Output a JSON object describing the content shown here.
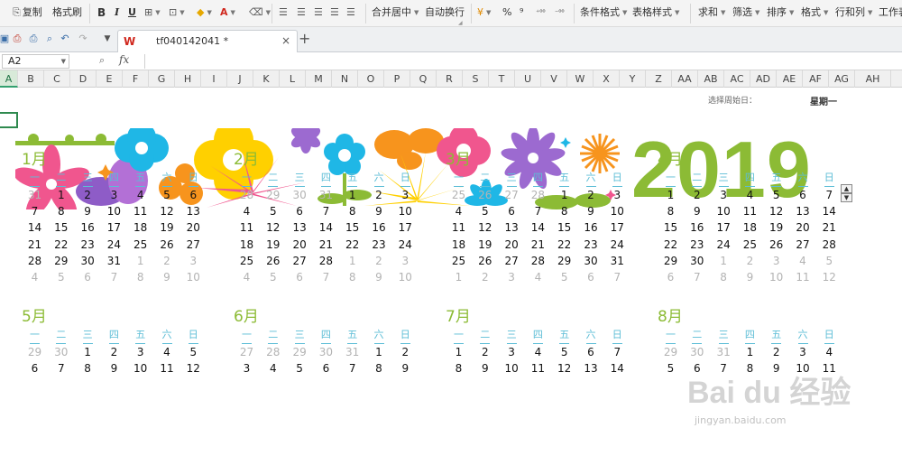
{
  "ribbon": {
    "copy": "复制",
    "format_painter": "格式刷",
    "bold": "B",
    "italic": "I",
    "underline": "U",
    "merge_center": "合并居中",
    "wrap_text": "自动换行",
    "percent": "%",
    "thousands": "⁹",
    "decimal_more": "⁺⁰⁰",
    "decimal_less": "⁻⁰⁰",
    "cond_format": "条件格式",
    "table_style": "表格样式",
    "sum": "求和",
    "filter": "筛选",
    "sort": "排序",
    "format": "格式",
    "row_col": "行和列",
    "worksheet": "工作表"
  },
  "tabbar": {
    "wps_logo": "W",
    "doc_title": "tf040142041 *",
    "close": "×",
    "new_tab": "+"
  },
  "formula_bar": {
    "name_box": "A2",
    "fx": "fx"
  },
  "columns": [
    "A",
    "B",
    "C",
    "D",
    "E",
    "F",
    "G",
    "H",
    "I",
    "J",
    "K",
    "L",
    "M",
    "N",
    "O",
    "P",
    "Q",
    "R",
    "S",
    "T",
    "U",
    "V",
    "W",
    "X",
    "Y",
    "Z",
    "AA",
    "AB",
    "AC",
    "AD",
    "AE",
    "AF",
    "AG",
    "AH"
  ],
  "sheet": {
    "select_start_label": "选择周始日：",
    "start_day": "星期一",
    "year": "2019",
    "weekdays": [
      "一",
      "二",
      "三",
      "四",
      "五",
      "六",
      "日"
    ],
    "months": [
      {
        "name": "1月",
        "rows": [
          [
            "31",
            "1",
            "2",
            "3",
            "4",
            "5",
            "6"
          ],
          [
            "7",
            "8",
            "9",
            "10",
            "11",
            "12",
            "13"
          ],
          [
            "14",
            "15",
            "16",
            "17",
            "18",
            "19",
            "20"
          ],
          [
            "21",
            "22",
            "23",
            "24",
            "25",
            "26",
            "27"
          ],
          [
            "28",
            "29",
            "30",
            "31",
            "1",
            "2",
            "3"
          ],
          [
            "4",
            "5",
            "6",
            "7",
            "8",
            "9",
            "10"
          ]
        ],
        "first": 1,
        "last": 31
      },
      {
        "name": "2月",
        "rows": [
          [
            "28",
            "29",
            "30",
            "31",
            "1",
            "2",
            "3"
          ],
          [
            "4",
            "5",
            "6",
            "7",
            "8",
            "9",
            "10"
          ],
          [
            "11",
            "12",
            "13",
            "14",
            "15",
            "16",
            "17"
          ],
          [
            "18",
            "19",
            "20",
            "21",
            "22",
            "23",
            "24"
          ],
          [
            "25",
            "26",
            "27",
            "28",
            "1",
            "2",
            "3"
          ],
          [
            "4",
            "5",
            "6",
            "7",
            "8",
            "9",
            "10"
          ]
        ],
        "first": 4,
        "last": 31
      },
      {
        "name": "3月",
        "rows": [
          [
            "25",
            "26",
            "27",
            "28",
            "1",
            "2",
            "3"
          ],
          [
            "4",
            "5",
            "6",
            "7",
            "8",
            "9",
            "10"
          ],
          [
            "11",
            "12",
            "13",
            "14",
            "15",
            "16",
            "17"
          ],
          [
            "18",
            "19",
            "20",
            "21",
            "22",
            "23",
            "24"
          ],
          [
            "25",
            "26",
            "27",
            "28",
            "29",
            "30",
            "31"
          ],
          [
            "1",
            "2",
            "3",
            "4",
            "5",
            "6",
            "7"
          ]
        ],
        "first": 4,
        "last": 34
      },
      {
        "name": "4月",
        "rows": [
          [
            "1",
            "2",
            "3",
            "4",
            "5",
            "6",
            "7"
          ],
          [
            "8",
            "9",
            "10",
            "11",
            "12",
            "13",
            "14"
          ],
          [
            "15",
            "16",
            "17",
            "18",
            "19",
            "20",
            "21"
          ],
          [
            "22",
            "23",
            "24",
            "25",
            "26",
            "27",
            "28"
          ],
          [
            "29",
            "30",
            "1",
            "2",
            "3",
            "4",
            "5"
          ],
          [
            "6",
            "7",
            "8",
            "9",
            "10",
            "11",
            "12"
          ]
        ],
        "first": 0,
        "last": 29
      },
      {
        "name": "5月",
        "rows": [
          [
            "29",
            "30",
            "1",
            "2",
            "3",
            "4",
            "5"
          ],
          [
            "6",
            "7",
            "8",
            "9",
            "10",
            "11",
            "12"
          ]
        ],
        "first": 2,
        "last": 99
      },
      {
        "name": "6月",
        "rows": [
          [
            "27",
            "28",
            "29",
            "30",
            "31",
            "1",
            "2"
          ],
          [
            "3",
            "4",
            "5",
            "6",
            "7",
            "8",
            "9"
          ]
        ],
        "first": 5,
        "last": 99
      },
      {
        "name": "7月",
        "rows": [
          [
            "1",
            "2",
            "3",
            "4",
            "5",
            "6",
            "7"
          ],
          [
            "8",
            "9",
            "10",
            "11",
            "12",
            "13",
            "14"
          ]
        ],
        "first": 0,
        "last": 99
      },
      {
        "name": "8月",
        "rows": [
          [
            "29",
            "30",
            "31",
            "1",
            "2",
            "3",
            "4"
          ],
          [
            "5",
            "6",
            "7",
            "8",
            "9",
            "10",
            "11"
          ]
        ],
        "first": 3,
        "last": 99
      }
    ]
  },
  "watermark": {
    "logo": "Bai du 经验",
    "url": "jingyan.baidu.com"
  },
  "colors": {
    "accent_green": "#8cbb35",
    "weekday_blue": "#5cbdd6",
    "selection_green": "#2f8a4f"
  }
}
